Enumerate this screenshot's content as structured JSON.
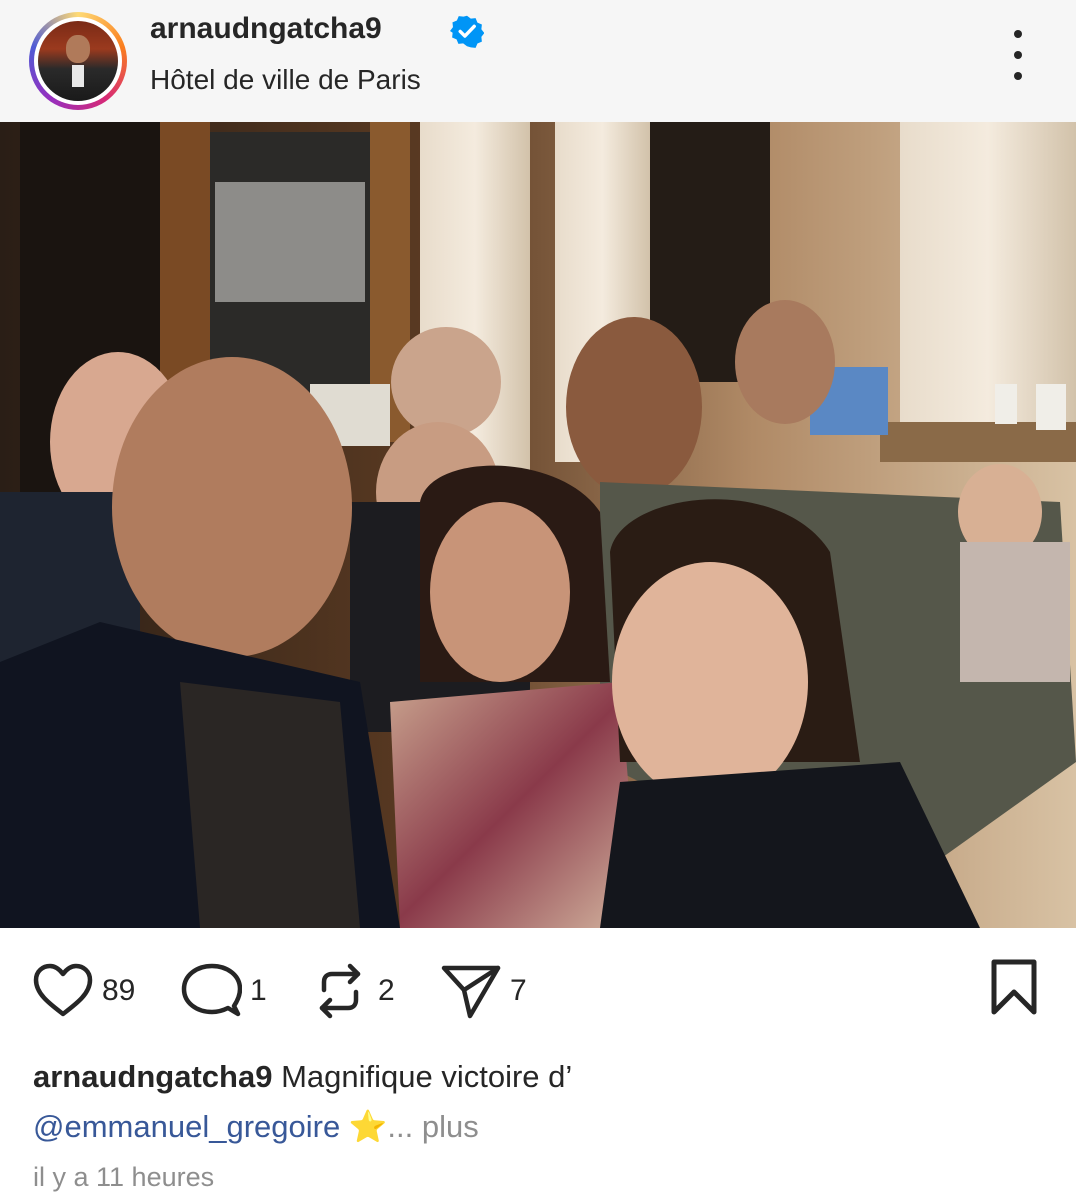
{
  "post": {
    "username": "arnaudngatcha9",
    "location": "Hôtel de ville de Paris"
  },
  "actions": {
    "likes": "89",
    "comments": "1",
    "reposts": "2",
    "shares": "7"
  },
  "caption": {
    "username": "arnaudngatcha9",
    "text": " Magnifique victoire d’",
    "mention": "@emmanuel_gregoire",
    "emoji": " ⭐",
    "ellipsis": "... ",
    "more_label": "plus"
  },
  "timestamp": "il y a 11 heures",
  "icons": {
    "verified": "verified-badge-icon",
    "more": "more-vertical-icon",
    "like": "heart-icon",
    "comment": "comment-bubble-icon",
    "repost": "repost-icon",
    "share": "paper-plane-icon",
    "save": "bookmark-icon"
  },
  "colors": {
    "verified_blue": "#0095f6",
    "mention": "#385898",
    "secondary_text": "#8e8e8e"
  }
}
